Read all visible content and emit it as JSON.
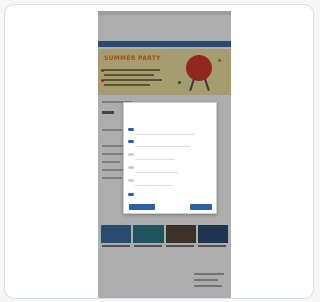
{
  "site": {
    "topbar_text": "",
    "title": "",
    "subtitle": "",
    "nav_items": []
  },
  "banner": {
    "title": "SUMMER PARTY",
    "grill_color": "#d63a2f",
    "background_color": "#f3e8a6",
    "title_color": "#e07a1e"
  },
  "cookie_modal": {
    "title": "",
    "description": "",
    "options": [
      {
        "label": "",
        "enabled": true
      },
      {
        "label": "",
        "enabled": true
      },
      {
        "label": "",
        "enabled": false
      },
      {
        "label": "",
        "enabled": false
      },
      {
        "label": "",
        "enabled": false
      },
      {
        "label": "",
        "enabled": true
      }
    ],
    "buttons": [
      {
        "label": ""
      },
      {
        "label": ""
      }
    ],
    "accent_color": "#2d5fa8"
  },
  "content": {
    "section_title": "",
    "ad_text": ""
  },
  "theme": {
    "nav_color": "#3a6ea5",
    "title_color": "#c0392b",
    "overlay": "rgba(0,0,0,0.32)"
  }
}
